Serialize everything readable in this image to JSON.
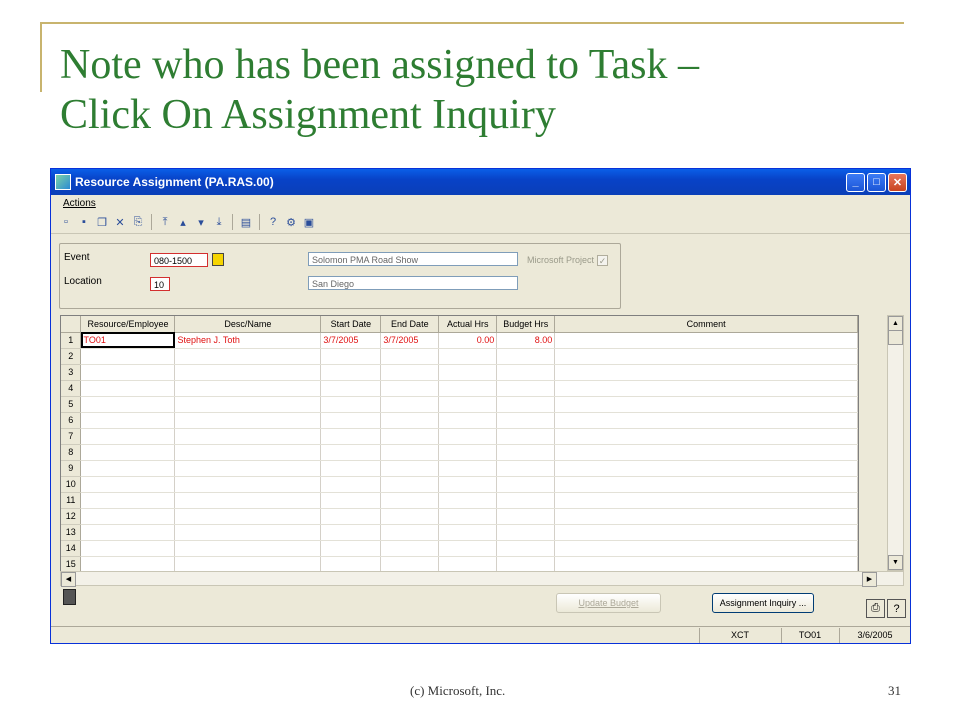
{
  "slide": {
    "title_line1": "Note who has been assigned to Task –",
    "title_line2": "Click On Assignment Inquiry",
    "footer_copyright": "(c) Microsoft, Inc.",
    "page_number": "31"
  },
  "window": {
    "title": "Resource Assignment (PA.RAS.00)",
    "minimize": "_",
    "maximize": "□",
    "close": "✕"
  },
  "menu": {
    "actions": "Actions"
  },
  "form": {
    "event_label": "Event",
    "event_value": "080-1500",
    "event_desc": "Solomon PMA Road Show",
    "location_label": "Location",
    "location_value": "10",
    "location_desc": "San Diego",
    "microsoft_project_label": "Microsoft Project"
  },
  "grid": {
    "columns": [
      "Resource/Employee",
      "Desc/Name",
      "Start Date",
      "End Date",
      "Actual Hrs",
      "Budget Hrs",
      "Comment"
    ],
    "row_numbers": [
      "1",
      "2",
      "3",
      "4",
      "5",
      "6",
      "7",
      "8",
      "9",
      "10",
      "11",
      "12",
      "13",
      "14",
      "15"
    ],
    "rows": [
      {
        "resource": "TO01",
        "desc": "Stephen J. Toth",
        "start": "3/7/2005",
        "end": "3/7/2005",
        "actual": "0.00",
        "budget": "8.00",
        "comment": ""
      }
    ]
  },
  "buttons": {
    "update_budget": "Update Budget",
    "assignment_inquiry": "Assignment Inquiry ..."
  },
  "status": {
    "company": "XCT",
    "user": "TO01",
    "date": "3/6/2005"
  },
  "icons": [
    "new-icon",
    "save-icon",
    "copy-icon",
    "delete-icon",
    "cancel-icon",
    "first-icon",
    "previous-icon",
    "next-icon",
    "last-icon",
    "print-icon",
    "help-icon",
    "customize-icon",
    "note-icon"
  ]
}
